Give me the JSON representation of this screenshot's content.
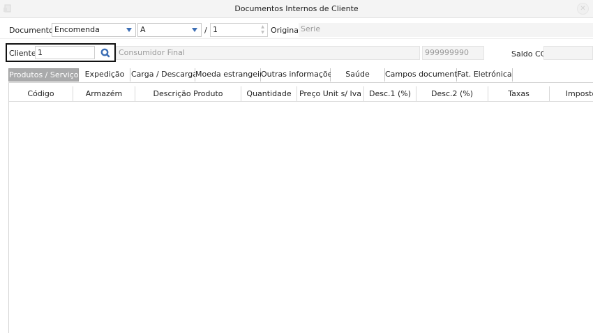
{
  "window": {
    "title": "Documentos Internos de Cliente"
  },
  "document": {
    "label": "Documento",
    "type_value": "Encomenda",
    "series_value": "A",
    "separator": "/",
    "number_value": "1",
    "original_label": "Original",
    "original_placeholder": "Serie"
  },
  "client": {
    "label": "Cliente",
    "code_value": "1",
    "name_value": "Consumidor Final",
    "nif_value": "999999990",
    "saldo_label": "Saldo CC",
    "saldo_value": ""
  },
  "tabs": [
    {
      "label": "Produtos / Serviços",
      "active": true
    },
    {
      "label": "Expedição"
    },
    {
      "label": "Carga / Descarga"
    },
    {
      "label": "Moeda estrangeira"
    },
    {
      "label": "Outras informações"
    },
    {
      "label": "Saúde"
    },
    {
      "label": "Campos documento"
    },
    {
      "label": "Fat. Eletrónica"
    }
  ],
  "grid": {
    "columns": [
      "Código",
      "Armazém",
      "Descrição Produto",
      "Quantidade",
      "Preço Unit s/ Iva",
      "Desc.1 (%)",
      "Desc.2 (%)",
      "Taxas",
      "Imposto"
    ]
  },
  "colors": {
    "accent": "#3d6fb5",
    "active_tab": "#a9aaab",
    "highlight_border": "#111111"
  }
}
